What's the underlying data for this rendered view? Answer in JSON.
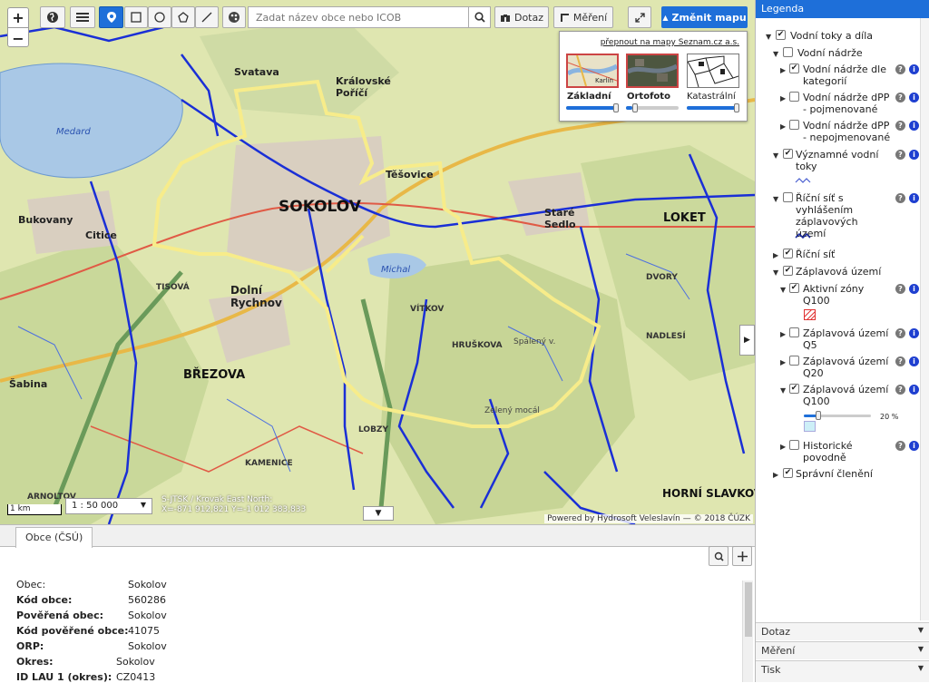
{
  "toolbar": {
    "search_placeholder": "Zadat název obce nebo ICOB",
    "dotaz": "Dotaz",
    "mereni": "Měření",
    "zmenit_mapu": "Změnit mapu",
    "zoom_in": "+",
    "zoom_out": "−"
  },
  "map_switcher": {
    "link": "přepnout na mapy Seznam.cz a.s.",
    "maps": [
      {
        "label": "Základní",
        "opacity_pct": 100
      },
      {
        "label": "Ortofoto",
        "opacity_pct": 0
      },
      {
        "label": "Katastrální",
        "opacity_pct": 100
      }
    ],
    "thumb_text": "Karlín"
  },
  "map": {
    "scale_bar": "1 km",
    "scale": "1 : 50 000",
    "coords_line1": "S-JTSK / Krovak East North:",
    "coords_line2": "X=-871 912,821 Y=-1 012 383,833",
    "attribution": "Powered by Hydrosoft Veleslavín — © 2018 ČÚZK",
    "labels": {
      "sokolov": "SOKOLOV",
      "svatava": "Svatava",
      "kralovske_porici": "Královské Poříčí",
      "tesovice": "Těšovice",
      "stare_sedlo": "Staré Sedlo",
      "loket": "LOKET",
      "bukovany": "Bukovany",
      "citice": "Citice",
      "dolni_rychnov": "Dolní Rychnov",
      "brezova": "BŘEZOVA",
      "sabina": "Šabina",
      "medard": "Medard",
      "michal": "Michal",
      "vitkov": "VÍTKOV",
      "hruskova": "HRUŠKOVA",
      "horni_slavkov": "HORNÍ SLAVKOV",
      "lobzy": "LOBZY",
      "kamenice": "KAMENICE",
      "arnoltov": "ARNOLTOV",
      "tisova": "TISOVÁ",
      "nadlesi": "NADLESÍ",
      "dvory": "DVORY",
      "spaleny_v": "Spálený v.",
      "zeleny_mocal": "Zelený mocál"
    }
  },
  "bottom": {
    "tab": "Obce (ČSÚ)",
    "rows": [
      {
        "label": "Obec:",
        "value": "Sokolov"
      },
      {
        "label": "Kód obce:",
        "value": "560286"
      },
      {
        "label": "Pověřená obec:",
        "value": "Sokolov"
      },
      {
        "label": "Kód pověřené obce:",
        "value": "41075"
      },
      {
        "label": "ORP:",
        "value": "Sokolov"
      },
      {
        "label": "Okres:",
        "value": "Sokolov"
      },
      {
        "label": "ID LAU 1 (okres):",
        "value": "CZ0413"
      }
    ]
  },
  "legend": {
    "title": "Legenda",
    "items": {
      "vodni_toky": "Vodní toky a díla",
      "vodni_nadrze": "Vodní nádrže",
      "nadrze_kategorie": "Vodní nádrže dle kategorií",
      "nadrze_dpp_poj": "Vodní nádrže dPP - pojmenované",
      "nadrze_dpp_nepoj": "Vodní nádrže dPP - nepojmenované",
      "vyznamne_toky": "Významné vodní toky",
      "ricni_sit_zaplav": "Říční síť s vyhlášením záplavových území",
      "ricni_sit": "Říční síť",
      "zaplavova_uzemi": "Záplavová území",
      "aktivni_zony": "Aktivní zóny Q100",
      "zaplav_q5": "Záplavová území Q5",
      "zaplav_q20": "Záplavová území Q20",
      "zaplav_q100": "Záplavová území Q100",
      "historicke": "Historické povodně",
      "spravni": "Správní členění"
    },
    "q100_opacity": "20 %"
  },
  "accordions": [
    "Dotaz",
    "Měření",
    "Tisk"
  ],
  "colors": {
    "accent": "#1e6fd9",
    "river": "#1a2fd6",
    "boundary": "#f7ec8a"
  }
}
